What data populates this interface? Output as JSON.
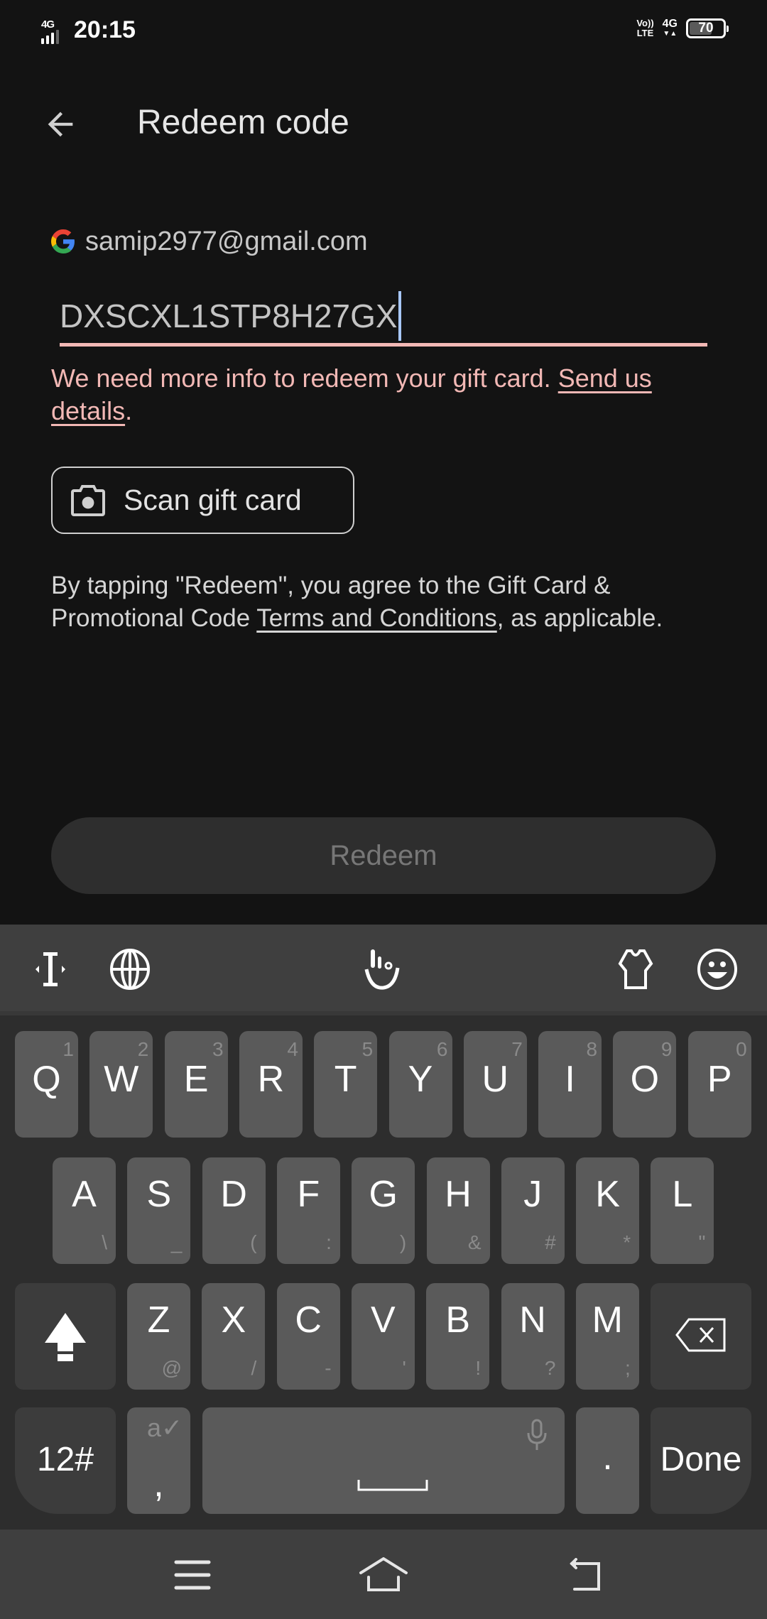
{
  "status_bar": {
    "network_left": "4G",
    "time": "20:15",
    "volte_top": "Vo))",
    "volte_bottom": "LTE",
    "network_right": "4G",
    "battery_level": "70",
    "battery_fraction": 0.7
  },
  "app_bar": {
    "back_icon": "arrow-back-icon",
    "title": "Redeem code"
  },
  "account": {
    "icon": "google-g-icon",
    "email": "samip2977@gmail.com"
  },
  "code_input": {
    "value": "DXSCXL1STP8H27GX",
    "underline_color": "#f2b8b5",
    "caret_color": "#a8c7fa"
  },
  "error": {
    "text": "We need more info to redeem your gift card. ",
    "link": "Send us details",
    "suffix": ".",
    "color": "#f2b8b5"
  },
  "scan_button": {
    "icon": "camera-icon",
    "label": "Scan gift card"
  },
  "terms": {
    "prefix": "By tapping \"Redeem\", you agree to the Gift Card & Promotional Code ",
    "link": "Terms and Conditions",
    "suffix": ", as applicable."
  },
  "redeem_button": {
    "label": "Redeem",
    "state": "disabled"
  },
  "keyboard": {
    "toolbar": [
      "cursor-move-icon",
      "globe-icon",
      "touchpal-logo-icon",
      "theme-shirt-icon",
      "emoji-icon"
    ],
    "row1": [
      {
        "key": "Q",
        "hint": "1"
      },
      {
        "key": "W",
        "hint": "2"
      },
      {
        "key": "E",
        "hint": "3"
      },
      {
        "key": "R",
        "hint": "4"
      },
      {
        "key": "T",
        "hint": "5"
      },
      {
        "key": "Y",
        "hint": "6"
      },
      {
        "key": "U",
        "hint": "7"
      },
      {
        "key": "I",
        "hint": "8"
      },
      {
        "key": "O",
        "hint": "9"
      },
      {
        "key": "P",
        "hint": "0"
      }
    ],
    "row2": [
      {
        "key": "A",
        "hint": "\\"
      },
      {
        "key": "S",
        "hint": "_"
      },
      {
        "key": "D",
        "hint": "("
      },
      {
        "key": "F",
        "hint": ":"
      },
      {
        "key": "G",
        "hint": ")"
      },
      {
        "key": "H",
        "hint": "&"
      },
      {
        "key": "J",
        "hint": "#"
      },
      {
        "key": "K",
        "hint": "*"
      },
      {
        "key": "L",
        "hint": "\""
      }
    ],
    "row3": [
      {
        "key": "Z",
        "hint": "@"
      },
      {
        "key": "X",
        "hint": "/"
      },
      {
        "key": "C",
        "hint": "-"
      },
      {
        "key": "V",
        "hint": "'"
      },
      {
        "key": "B",
        "hint": "!"
      },
      {
        "key": "N",
        "hint": "?"
      },
      {
        "key": "M",
        "hint": ";"
      }
    ],
    "shift_icon": "shift-icon",
    "backspace_icon": "backspace-icon",
    "symbols_label": "12#",
    "comma_label": ",",
    "comma_hint": "a✓",
    "space_hint_icon": "microphone-icon",
    "period_label": ".",
    "done_label": "Done"
  },
  "nav_bar": [
    "menu-icon",
    "home-icon",
    "back-icon"
  ]
}
